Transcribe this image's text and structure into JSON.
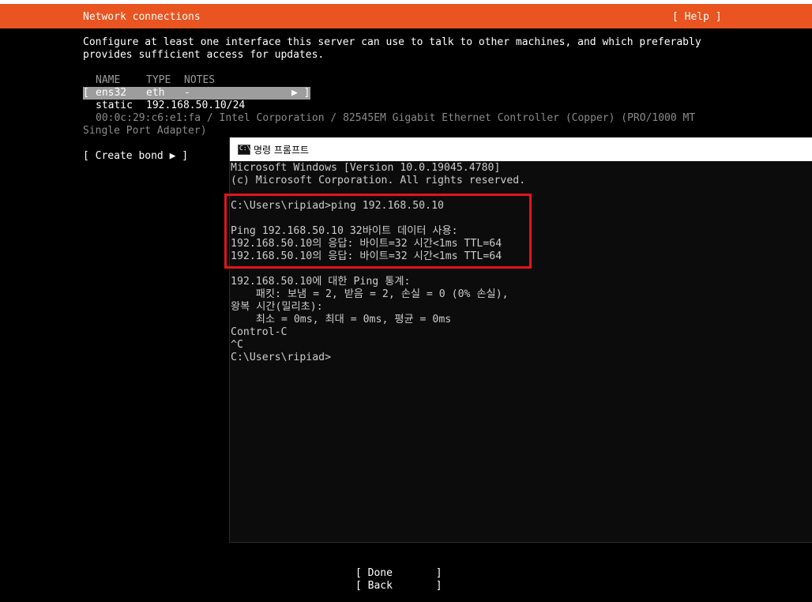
{
  "installer": {
    "header_title": "Network connections",
    "help_label": "[ Help ]",
    "description": "Configure at least one interface this server can use to talk to other machines, and which preferably\nprovides sufficient access for updates.",
    "columns": {
      "name": "NAME",
      "type": "TYPE",
      "notes": "NOTES"
    },
    "interface": {
      "bracket_open": "[",
      "name": "ens32",
      "type": "eth",
      "notes": "-",
      "arrow": "▶ ]",
      "address_mode": "static",
      "address": "192.168.50.10/24",
      "hardware_line1": "00:0c:29:c6:e1:fa / Intel Corporation / 82545EM Gigabit Ethernet Controller (Copper) (PRO/1000 MT",
      "hardware_line2": "Single Port Adapter)"
    },
    "create_bond_label": "[ Create bond ▶ ]",
    "done_label": "[ Done       ]",
    "back_label": "[ Back       ]"
  },
  "cmd": {
    "icon_text": "C:\\",
    "title": "명령 프롬프트",
    "lines": [
      "Microsoft Windows [Version 10.0.19045.4780]",
      "(c) Microsoft Corporation. All rights reserved.",
      "",
      "C:\\Users\\ripiad>ping 192.168.50.10",
      "",
      "Ping 192.168.50.10 32바이트 데이터 사용:",
      "192.168.50.10의 응답: 바이트=32 시간<1ms TTL=64",
      "192.168.50.10의 응답: 바이트=32 시간<1ms TTL=64",
      "",
      "192.168.50.10에 대한 Ping 통계:",
      "    패킷: 보냄 = 2, 받음 = 2, 손실 = 0 (0% 손실),",
      "왕복 시간(밀리초):",
      "    최소 = 0ms, 최대 = 0ms, 평균 = 0ms",
      "Control-C",
      "^C",
      "C:\\Users\\ripiad>"
    ]
  },
  "colors": {
    "header": "#e95420",
    "selection": "#9d9d9d",
    "highlight_box": "#e3141e"
  }
}
